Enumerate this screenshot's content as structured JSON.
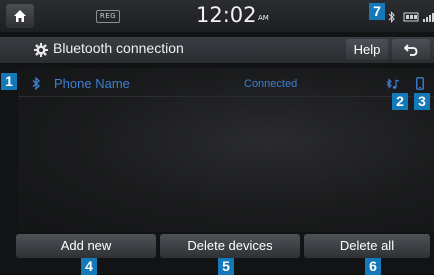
{
  "status_bar": {
    "time": "12:02",
    "ampm": "AM",
    "media_label": "REG"
  },
  "title_bar": {
    "title": "Bluetooth connection",
    "help_label": "Help"
  },
  "device_list": {
    "items": [
      {
        "name": "Phone Name",
        "status": "Connected"
      }
    ]
  },
  "buttons": {
    "add_new": "Add new",
    "delete_devices": "Delete devices",
    "delete_all": "Delete all"
  },
  "callouts": [
    "1",
    "2",
    "3",
    "4",
    "5",
    "6",
    "7"
  ],
  "colors": {
    "accent_blue": "#3f7fd1",
    "callout_blue": "#1479b9"
  },
  "icons": [
    "home-icon",
    "gear-icon",
    "back-arrow-icon",
    "bluetooth-icon",
    "bluetooth-audio-icon",
    "phone-icon",
    "battery-icon",
    "signal-icon"
  ]
}
